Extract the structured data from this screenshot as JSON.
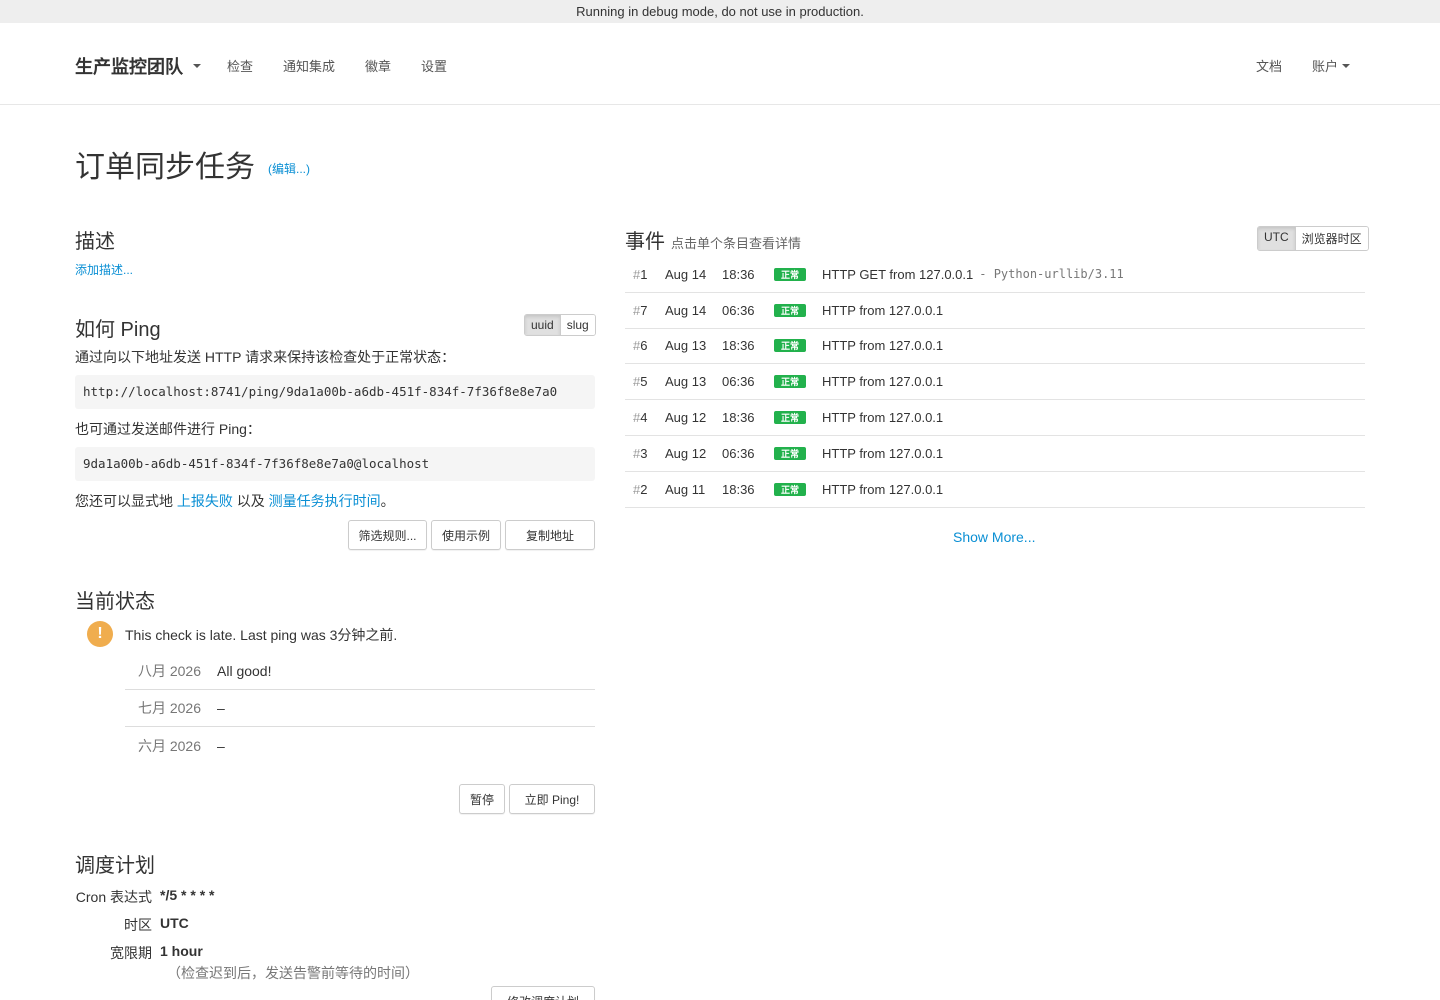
{
  "debug_banner": "Running in debug mode, do not use in production.",
  "nav": {
    "brand": "生产监控团队",
    "items": [
      {
        "label": "检查"
      },
      {
        "label": "通知集成"
      },
      {
        "label": "徽章"
      },
      {
        "label": "设置"
      }
    ],
    "docs": "文档",
    "account": "账户"
  },
  "page": {
    "title": "订单同步任务",
    "edit_link": "(编辑...)"
  },
  "description": {
    "heading": "描述",
    "add_link": "添加描述..."
  },
  "ping": {
    "heading": "如何 Ping",
    "toggle": [
      "uuid",
      "slug"
    ],
    "active_toggle": "uuid",
    "intro": "通过向以下地址发送 HTTP 请求来保持该检查处于正常状态：",
    "url": "http://localhost:8741/ping/9da1a00b-a6db-451f-834f-7f36f8e8e7a0",
    "email_intro": "也可通过发送邮件进行 Ping：",
    "email": "9da1a00b-a6db-451f-834f-7f36f8e8e7a0@localhost",
    "also_prefix": "您还可以显式地 ",
    "also_link1": "上报失败",
    "also_middle": " 以及 ",
    "also_link2": "测量任务执行时间",
    "also_suffix": "。",
    "buttons": {
      "filter": "筛选规则...",
      "examples": "使用示例",
      "copy": "复制地址"
    }
  },
  "status": {
    "heading": "当前状态",
    "message": "This check is late. Last ping was 3分钟之前.",
    "months": [
      {
        "month": "八月 2026",
        "value": "All good!"
      },
      {
        "month": "七月 2026",
        "value": "–"
      },
      {
        "month": "六月 2026",
        "value": "–"
      }
    ],
    "buttons": {
      "pause": "暂停",
      "ping_now": "立即 Ping!"
    }
  },
  "schedule": {
    "heading": "调度计划",
    "cron_label": "Cron 表达式",
    "cron_value": "*/5 * * * *",
    "tz_label": "时区",
    "tz_value": "UTC",
    "grace_label": "宽限期",
    "grace_value": "1 hour",
    "grace_note": "（检查迟到后，发送告警前等待的时间）",
    "change_button": "修改调度计划"
  },
  "events": {
    "heading": "事件",
    "hint": "点击单个条目查看详情",
    "tz_toggle": [
      "UTC",
      "浏览器时区"
    ],
    "active_tz": "UTC",
    "items": [
      {
        "hash": "#",
        "num": "1",
        "date": "Aug 14",
        "time": "18:36",
        "badge": "正常",
        "desc": "HTTP GET from 127.0.0.1",
        "ua": " - Python-urllib/3.11"
      },
      {
        "hash": "#",
        "num": "7",
        "date": "Aug 14",
        "time": "06:36",
        "badge": "正常",
        "desc": "HTTP from 127.0.0.1",
        "ua": ""
      },
      {
        "hash": "#",
        "num": "6",
        "date": "Aug 13",
        "time": "18:36",
        "badge": "正常",
        "desc": "HTTP from 127.0.0.1",
        "ua": ""
      },
      {
        "hash": "#",
        "num": "5",
        "date": "Aug 13",
        "time": "06:36",
        "badge": "正常",
        "desc": "HTTP from 127.0.0.1",
        "ua": ""
      },
      {
        "hash": "#",
        "num": "4",
        "date": "Aug 12",
        "time": "18:36",
        "badge": "正常",
        "desc": "HTTP from 127.0.0.1",
        "ua": ""
      },
      {
        "hash": "#",
        "num": "3",
        "date": "Aug 12",
        "time": "06:36",
        "badge": "正常",
        "desc": "HTTP from 127.0.0.1",
        "ua": ""
      },
      {
        "hash": "#",
        "num": "2",
        "date": "Aug 11",
        "time": "18:36",
        "badge": "正常",
        "desc": "HTTP from 127.0.0.1",
        "ua": ""
      }
    ],
    "show_more": "Show More..."
  },
  "colors": {
    "link": "#0a8fd4",
    "success_badge": "#22b14c",
    "warning": "#f0ad4e"
  }
}
